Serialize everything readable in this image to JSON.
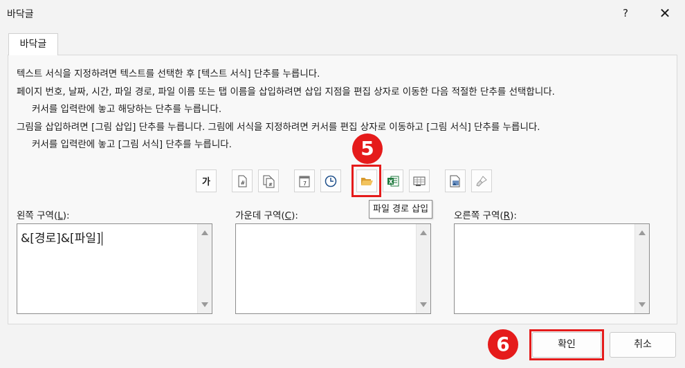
{
  "window": {
    "title": "바닥글",
    "help_label": "?",
    "close_label": "✕"
  },
  "tab": {
    "label": "바닥글"
  },
  "instructions": [
    "텍스트 서식을 지정하려면 텍스트를 선택한 후 [텍스트 서식] 단추를 누릅니다.",
    "페이지 번호, 날짜, 시간, 파일 경로, 파일 이름 또는 탭 이름을 삽입하려면 삽입 지점을 편집 상자로 이동한 다음 적절한 단추를 선택합니다.",
    "커서를 입력란에 놓고 해당하는 단추를 누릅니다.",
    "그림을 삽입하려면 [그림 삽입] 단추를 누릅니다.  그림에 서식을 지정하려면 커서를 편집 상자로 이동하고 [그림 서식] 단추를 누릅니다.",
    "커서를 입력란에 놓고 [그림 서식] 단추를 누릅니다."
  ],
  "toolbar": {
    "format_text_label": "가",
    "tooltip": "파일 경로 삽입"
  },
  "sections": {
    "left": {
      "label_pre": "왼쪽 구역(",
      "hotkey": "L",
      "label_post": "):",
      "value": "&[경로]&[파일]"
    },
    "center": {
      "label_pre": "가운데 구역(",
      "hotkey": "C",
      "label_post": "):",
      "value": ""
    },
    "right": {
      "label_pre": "오른쪽 구역(",
      "hotkey": "R",
      "label_post": "):",
      "value": ""
    }
  },
  "markers": {
    "step5": "5",
    "step6": "6"
  },
  "buttons": {
    "ok": "확인",
    "cancel": "취소"
  },
  "colors": {
    "marker": "#e51b1b",
    "excel_green": "#1f7a3e",
    "folder": "#e8b04a"
  }
}
